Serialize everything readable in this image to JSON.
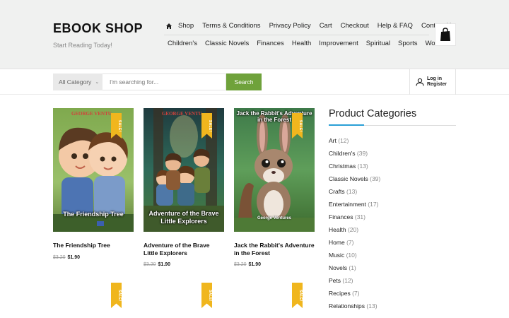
{
  "brand": {
    "title": "EBOOK SHOP",
    "tagline": "Start Reading Today!"
  },
  "menu_primary": [
    "Shop",
    "Terms & Conditions",
    "Privacy Policy",
    "Cart",
    "Checkout",
    "Help & FAQ",
    "Contact Us"
  ],
  "menu_secondary": [
    "Children's",
    "Classic Novels",
    "Finances",
    "Health",
    "Improvement",
    "Spiritual",
    "Sports",
    "Women"
  ],
  "search": {
    "category": "All Category",
    "placeholder": "I'm searching for...",
    "button": "Search"
  },
  "account": {
    "login": "Log in",
    "register": "Register"
  },
  "products": [
    {
      "title": "The Friendship Tree",
      "old_price": "$3.20",
      "price": "$1.90",
      "badge": "SALE!",
      "cover_top": "GEORGE VENTU...",
      "cover_title": "The Friendship Tree",
      "cover_author": ""
    },
    {
      "title": "Adventure of the Brave Little Explorers",
      "old_price": "$3.20",
      "price": "$1.90",
      "badge": "SALE!",
      "cover_top": "GEORGE VENTU...",
      "cover_title": "Adventure of the Brave Little Explorers",
      "cover_author": ""
    },
    {
      "title": "Jack the Rabbit's Adventure in the Forest",
      "old_price": "$3.20",
      "price": "$1.90",
      "badge": "SALE!",
      "cover_top": "Jack the Rabbit's Adventure in the Forest",
      "cover_title": "",
      "cover_author": "George Ventures"
    }
  ],
  "lower_badges": [
    "SALE!",
    "SALE!",
    "SALE!"
  ],
  "sidebar": {
    "heading": "Product Categories",
    "categories": [
      {
        "name": "Art",
        "count": "(12)"
      },
      {
        "name": "Children's",
        "count": "(39)"
      },
      {
        "name": "Christmas",
        "count": "(13)"
      },
      {
        "name": "Classic Novels",
        "count": "(39)"
      },
      {
        "name": "Crafts",
        "count": "(13)"
      },
      {
        "name": "Entertainment",
        "count": "(17)"
      },
      {
        "name": "Finances",
        "count": "(31)"
      },
      {
        "name": "Health",
        "count": "(20)"
      },
      {
        "name": "Home",
        "count": "(7)"
      },
      {
        "name": "Music",
        "count": "(10)"
      },
      {
        "name": "Novels",
        "count": "(1)"
      },
      {
        "name": "Pets",
        "count": "(12)"
      },
      {
        "name": "Recipes",
        "count": "(7)"
      },
      {
        "name": "Relationships",
        "count": "(13)"
      }
    ]
  },
  "icons": {
    "home": "home-icon",
    "cart": "shopping-bag-icon",
    "user": "user-icon",
    "chevron": "chevron-down-icon"
  },
  "colors": {
    "header_bg": "#f0f1f0",
    "search_button": "#6fa23b",
    "sale_ribbon": "#f0b61e",
    "accent_line": "#2a9fd6"
  }
}
